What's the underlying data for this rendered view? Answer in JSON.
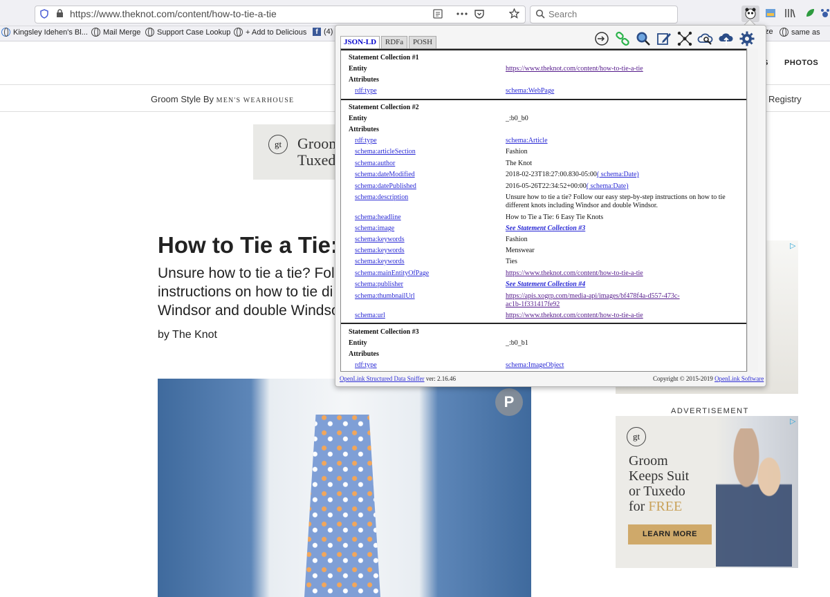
{
  "browser": {
    "url": "https://www.theknot.com/content/how-to-tie-a-tie",
    "search_placeholder": "Search"
  },
  "bookmarks": [
    {
      "label": "Kingsley Idehen's Bl..."
    },
    {
      "label": "Mail Merge"
    },
    {
      "label": "Support Case Lookup"
    },
    {
      "label": "+ Add to Delicious"
    },
    {
      "label": "(4)"
    },
    {
      "label": "ze"
    },
    {
      "label": "same as"
    }
  ],
  "site": {
    "nav_partial": "S",
    "nav_photos": "PHOTOS",
    "groom_style_prefix": "Groom Style By ",
    "groom_style_brand": "MEN'S WEARHOUSE",
    "registry": "Registry",
    "top_ad_text": "Groom\nTuxed",
    "top_ad_logo": "gt",
    "headline": "How to Tie a Tie: 6",
    "dek_line1": "Unsure how to tie a tie? Follo",
    "dek_line2": "instructions on how to tie di",
    "dek_line3": "Windsor and double Windso",
    "byline": "by The Knot",
    "pinterest": "P",
    "ad_label": "ADVERTISEMENT",
    "ad_logo": "gt",
    "ad_line1": "Groom",
    "ad_line2": "Keeps Suit",
    "ad_line3": "or Tuxedo",
    "ad_line4_prefix": "for ",
    "ad_line4_free": "FREE",
    "ad_cta": "LEARN MORE",
    "ad_choice": "▷"
  },
  "sniffer": {
    "tabs": [
      "JSON-LD",
      "RDFa",
      "POSH"
    ],
    "collections": [
      {
        "title": "Statement Collection #1",
        "entity": "https://www.theknot.com/content/how-to-tie-a-tie",
        "attrs": [
          {
            "k": "rdf:type",
            "v": "schema:WebPage"
          }
        ]
      },
      {
        "title": "Statement Collection #2",
        "entity": "_:b0_b0",
        "attrs": [
          {
            "k": "rdf:type",
            "v": "schema:Article"
          },
          {
            "k": "schema:articleSection",
            "v": "Fashion"
          },
          {
            "k": "schema:author",
            "v": "The Knot"
          },
          {
            "k": "schema:dateModified",
            "v": "2018-02-23T18:27:00.830-05:00",
            "dt": "( schema:Date)"
          },
          {
            "k": "schema:datePublished",
            "v": "2016-05-26T22:34:52+00:00",
            "dt": "( schema:Date)"
          },
          {
            "k": "schema:description",
            "v": "Unsure how to tie a tie? Follow our easy step-by-step instructions on how to tie",
            "v2": "different knots including Windsor and double Windsor."
          },
          {
            "k": "schema:headline",
            "v": "How to Tie a Tie: 6 Easy Tie Knots"
          },
          {
            "k": "schema:image",
            "v": "See Statement Collection #3"
          },
          {
            "k": "schema:keywords",
            "v": "Fashion"
          },
          {
            "k": "schema:keywords",
            "v": "Menswear"
          },
          {
            "k": "schema:keywords",
            "v": "Ties"
          },
          {
            "k": "schema:mainEntityOfPage",
            "v": "https://www.theknot.com/content/how-to-tie-a-tie"
          },
          {
            "k": "schema:publisher",
            "v": "See Statement Collection #4"
          },
          {
            "k": "schema:thumbnailUrl",
            "v": "https://apis.xogrp.com/media-api/images/bf478f4a-d557-473c-",
            "v2": "ac1b-1f331417fe92"
          },
          {
            "k": "schema:url",
            "v": "https://www.theknot.com/content/how-to-tie-a-tie"
          }
        ]
      },
      {
        "title": "Statement Collection #3",
        "entity": "_:b0_b1",
        "attrs": [
          {
            "k": "rdf:type",
            "v": "schema:ImageObject"
          }
        ]
      }
    ],
    "labels": {
      "entity": "Entity",
      "attributes": "Attributes"
    },
    "footer_link": "OpenLink Structured Data Sniffer",
    "footer_version": " ver: 2.16.46",
    "copyright_prefix": "Copyright © 2015-2019 ",
    "copyright_link": "OpenLink Software"
  }
}
